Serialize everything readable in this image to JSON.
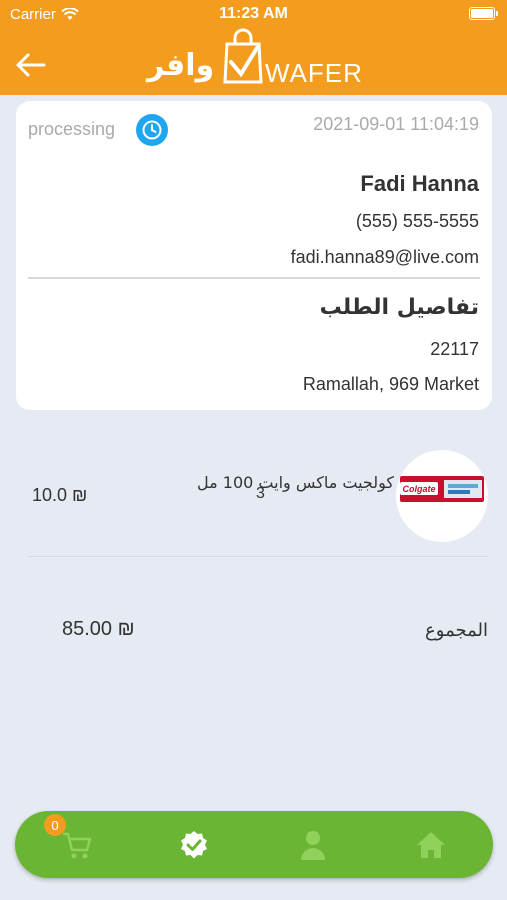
{
  "status_bar": {
    "carrier": "Carrier",
    "time": "11:23 AM"
  },
  "header": {
    "logo_arabic": "وافر",
    "logo_english": "WAFER"
  },
  "order": {
    "status": "processing",
    "date": "2021-09-01 11:04:19",
    "customer_name": "Fadi Hanna",
    "phone": "(555) 555-5555",
    "email": "fadi.hanna89@live.com",
    "details_title": "تفاصيل الطلب",
    "postal_code": "22117",
    "address": "Ramallah, 969 Market"
  },
  "items": [
    {
      "name": "كولجيت ماكس وايت 100 مل",
      "quantity": "3",
      "price": "10.0 ₪",
      "image_text": "Colgate"
    }
  ],
  "total": {
    "label": "المجموع",
    "value": "85.00 ₪"
  },
  "bottom_nav": {
    "cart_count": "0",
    "items": [
      "cart-icon",
      "orders-check-icon",
      "profile-icon",
      "home-icon"
    ]
  },
  "colors": {
    "header": "#f39c1e",
    "nav": "#6bb534",
    "accent": "#1ea7f0"
  }
}
